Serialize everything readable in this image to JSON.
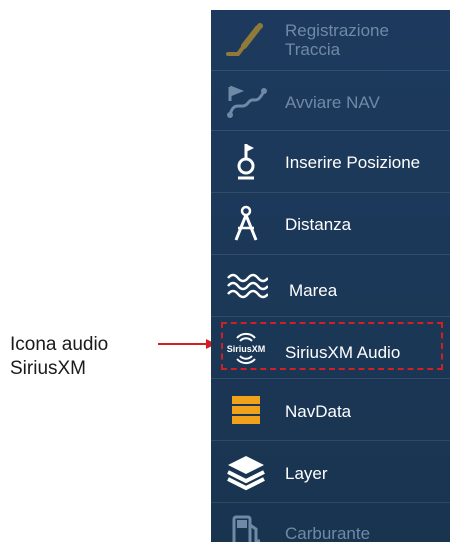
{
  "callout": {
    "line1": "Icona audio",
    "line2": "SiriusXM"
  },
  "menu": {
    "items": [
      {
        "label_line1": "Registrazione",
        "label_line2": "Traccia",
        "icon": "track-record-icon",
        "enabled": false
      },
      {
        "label": "Avviare NAV",
        "icon": "start-nav-icon",
        "enabled": false
      },
      {
        "label": "Inserire Posizione",
        "icon": "enter-position-icon",
        "enabled": true
      },
      {
        "label": "Distanza",
        "icon": "distance-compass-icon",
        "enabled": true
      },
      {
        "label": "Marea",
        "icon": "tide-waves-icon",
        "enabled": true
      },
      {
        "label": "SiriusXM Audio",
        "icon": "siriusxm-audio-icon",
        "enabled": true,
        "icon_text": "SiriusXM"
      },
      {
        "label": "NavData",
        "icon": "navdata-icon",
        "enabled": true
      },
      {
        "label": "Layer",
        "icon": "layers-icon",
        "enabled": true
      },
      {
        "label": "Carburante",
        "icon": "fuel-icon",
        "enabled": false
      }
    ]
  },
  "colors": {
    "panel": "#1b3858",
    "callout_red": "#d21e25",
    "navdata_orange": "#f0a21a",
    "disabled_text": "#6f8aa6"
  }
}
